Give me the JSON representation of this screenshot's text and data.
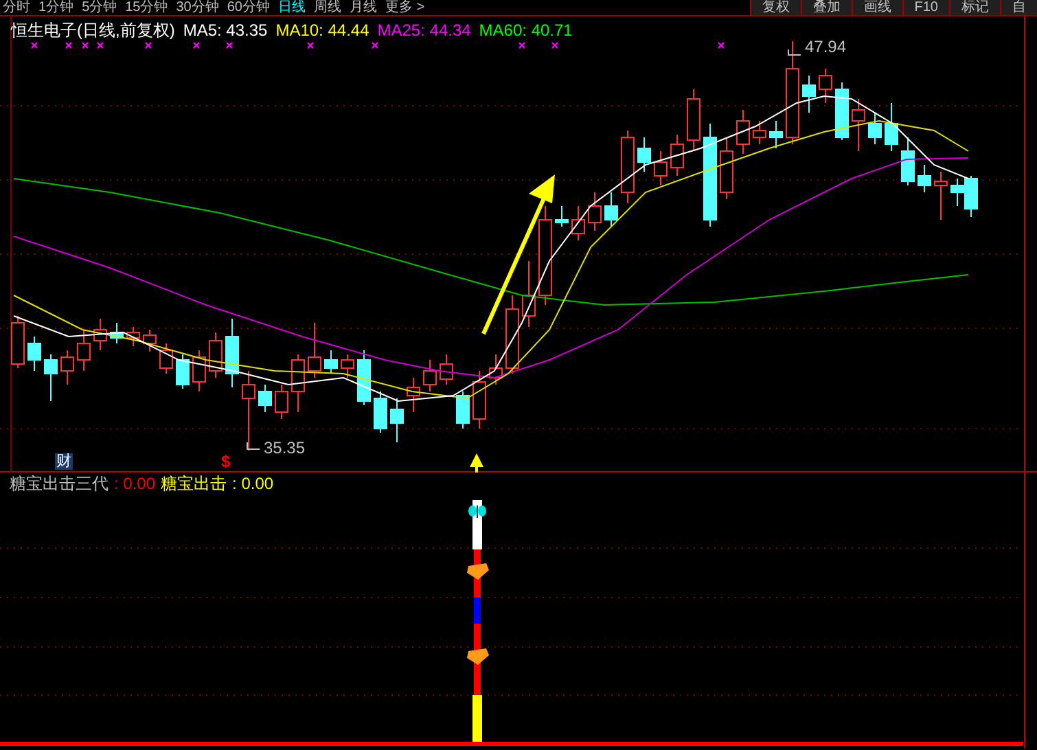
{
  "period_tabs": [
    {
      "label": "分时",
      "selected": false
    },
    {
      "label": "1分钟",
      "selected": false
    },
    {
      "label": "5分钟",
      "selected": false
    },
    {
      "label": "15分钟",
      "selected": false
    },
    {
      "label": "30分钟",
      "selected": false
    },
    {
      "label": "60分钟",
      "selected": false
    },
    {
      "label": "日线",
      "selected": true
    },
    {
      "label": "周线",
      "selected": false
    },
    {
      "label": "月线",
      "selected": false
    },
    {
      "label": "更多 >",
      "selected": false
    }
  ],
  "toolbar_buttons": [
    "复权",
    "叠加",
    "画线",
    "F10",
    "标记",
    "自"
  ],
  "main_legend": [
    {
      "text": "恒生电子(日线,前复权)",
      "color": "#ffffff"
    },
    {
      "text": "MA5: 43.35",
      "color": "#ffffff"
    },
    {
      "text": "MA10: 44.44",
      "color": "#ffff00"
    },
    {
      "text": "MA25: 44.34",
      "color": "#ff00ff"
    },
    {
      "text": "MA60: 40.71",
      "color": "#00ff00"
    }
  ],
  "high_label": "47.94",
  "low_label": "35.35",
  "finance_badge": "财",
  "dollar_mark": "$",
  "indicator_legend": [
    {
      "text": "糖宝出击三代",
      "color": "#c0c0c0"
    },
    {
      "text": ": 0.00",
      "color": "#ff0000"
    },
    {
      "text": "糖宝出击",
      "color": "#ffff00"
    },
    {
      "text": ": 0.00",
      "color": "#ffff00"
    }
  ]
}
